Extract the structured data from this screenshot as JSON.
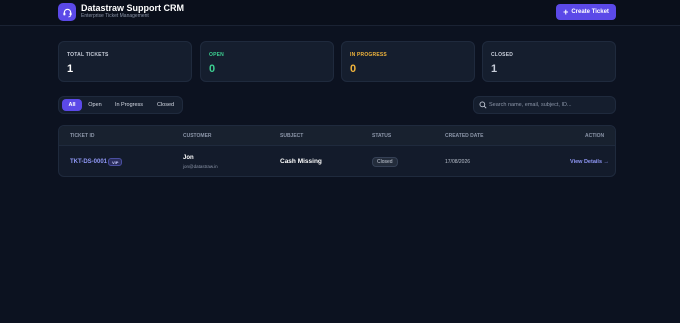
{
  "header": {
    "title": "Datastraw Support CRM",
    "subtitle": "Enterprise Ticket Management",
    "logo_icon": "headset-icon",
    "create_button": "Create Ticket",
    "create_icon": "plus-icon"
  },
  "stats": [
    {
      "label": "TOTAL TICKETS",
      "value": "1",
      "color": "#c6ccd8"
    },
    {
      "label": "OPEN",
      "value": "0",
      "color": "#3ccf91"
    },
    {
      "label": "IN PROGRESS",
      "value": "0",
      "color": "#f0b43c"
    },
    {
      "label": "CLOSED",
      "value": "1",
      "color": "#c6ccd8"
    }
  ],
  "filters": {
    "tabs": [
      "All",
      "Open",
      "In Progress",
      "Closed"
    ],
    "active": "All"
  },
  "search": {
    "placeholder": "Search name, email, subject, ID..."
  },
  "table": {
    "columns": [
      "TICKET ID",
      "CUSTOMER",
      "SUBJECT",
      "STATUS",
      "CREATED DATE",
      "ACTION"
    ],
    "rows": [
      {
        "ticket_id": "TKT-DS-0001",
        "badge": "VIP",
        "customer_name": "Jon",
        "customer_email": "jon@datastraw.in",
        "subject": "Cash Missing",
        "status": "Closed",
        "created": "17/08/2026",
        "action": "View Details →"
      }
    ]
  },
  "colors": {
    "accent": "#5b49e8",
    "background": "#0c1220",
    "card": "#151e2e",
    "link": "#8f97f5"
  }
}
